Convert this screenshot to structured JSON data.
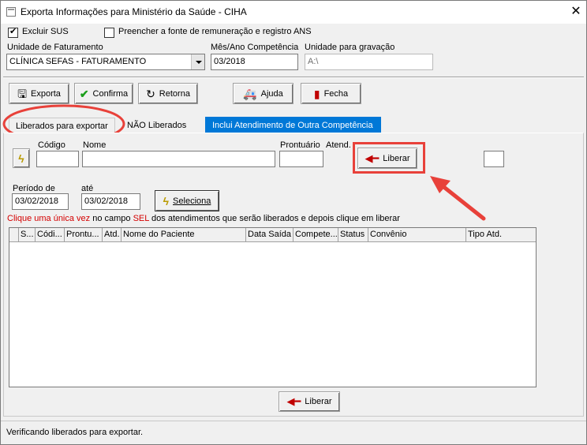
{
  "window": {
    "title": "Exporta Informações para Ministério da Saúde - CIHA",
    "close_label": "✕"
  },
  "options": {
    "excluir_sus": {
      "label": "Excluir SUS",
      "checked": true
    },
    "preencher_ans": {
      "label": "Preencher a fonte de remuneração e registro ANS",
      "checked": false
    }
  },
  "fields": {
    "unidade_faturamento": {
      "label": "Unidade de Faturamento",
      "value": "CLÍNICA SEFAS - FATURAMENTO"
    },
    "mes_ano": {
      "label": "Mês/Ano Competência",
      "value": "03/2018"
    },
    "unidade_gravacao": {
      "label": "Unidade para gravação",
      "value": "A:\\"
    }
  },
  "toolbar": {
    "exporta": "Exporta",
    "confirma": "Confirma",
    "retorna": "Retorna",
    "ajuda": "Ajuda",
    "fecha": "Fecha"
  },
  "tabs": [
    {
      "label": "Liberados para exportar"
    },
    {
      "label": "NÃO Liberados"
    },
    {
      "label": "Inclui Atendimento de Outra Competência"
    }
  ],
  "filters": {
    "codigo_label": "Código",
    "nome_label": "Nome",
    "prontuario_label": "Prontuário",
    "atend_label": "Atend.",
    "liberar_label": "Liberar",
    "periodo_label": "Período de",
    "periodo_de": "03/02/2018",
    "ate_label": "até",
    "periodo_ate": "03/02/2018",
    "seleciona_label": "Seleciona"
  },
  "instruction": {
    "part1": "Clique uma única vez",
    "part2": " no campo ",
    "part3": "SEL",
    "part4": " dos atendimentos que serão liberados e depois clique em liberar"
  },
  "grid": {
    "columns": [
      "S...",
      "Códi...",
      "Prontu...",
      "Atd.",
      "Nome do Paciente",
      "Data Saída",
      "Compete...",
      "Status",
      "Convênio",
      "Tipo Atd."
    ]
  },
  "bottom": {
    "liberar_label": "Liberar"
  },
  "status": {
    "text": "Verificando liberados para exportar."
  },
  "colors": {
    "tab_selected": "#0078d7",
    "annotation": "#e8413a",
    "instruction_red": "#d40000"
  },
  "icons": [
    "exporta-icon",
    "check-icon",
    "retorna-icon",
    "ajuda-icon",
    "fecha-icon",
    "lightning-icon",
    "arrow-left-icon"
  ]
}
